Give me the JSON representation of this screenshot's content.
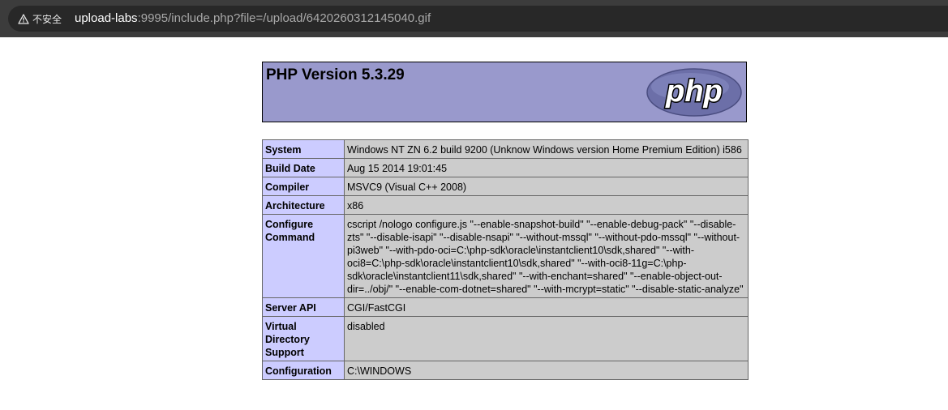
{
  "browser": {
    "security_label": "不安全",
    "url_host": "upload-labs",
    "url_rest": ":9995/include.php?file=/upload/6420260312145040.gif"
  },
  "phpinfo": {
    "title": "PHP Version 5.3.29",
    "logo_text": "php",
    "rows": [
      {
        "key": "System",
        "value": "Windows NT ZN 6.2 build 9200 (Unknow Windows version Home Premium Edition) i586"
      },
      {
        "key": "Build Date",
        "value": "Aug 15 2014 19:01:45"
      },
      {
        "key": "Compiler",
        "value": "MSVC9 (Visual C++ 2008)"
      },
      {
        "key": "Architecture",
        "value": "x86"
      },
      {
        "key": "Configure Command",
        "value": "cscript /nologo configure.js \"--enable-snapshot-build\" \"--enable-debug-pack\" \"--disable-zts\" \"--disable-isapi\" \"--disable-nsapi\" \"--without-mssql\" \"--without-pdo-mssql\" \"--without-pi3web\" \"--with-pdo-oci=C:\\php-sdk\\oracle\\instantclient10\\sdk,shared\" \"--with-oci8=C:\\php-sdk\\oracle\\instantclient10\\sdk,shared\" \"--with-oci8-11g=C:\\php-sdk\\oracle\\instantclient11\\sdk,shared\" \"--with-enchant=shared\" \"--enable-object-out-dir=../obj/\" \"--enable-com-dotnet=shared\" \"--with-mcrypt=static\" \"--disable-static-analyze\""
      },
      {
        "key": "Server API",
        "value": "CGI/FastCGI"
      },
      {
        "key": "Virtual Directory Support",
        "value": "disabled"
      },
      {
        "key": "Configuration",
        "value": "C:\\WINDOWS"
      }
    ]
  }
}
